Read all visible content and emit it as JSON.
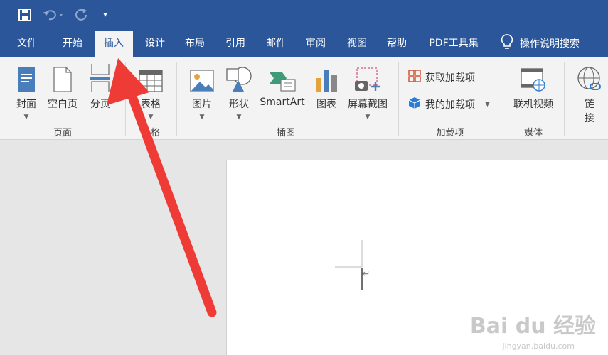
{
  "quick_access": {
    "more_symbol": "▾"
  },
  "tabs": [
    "文件",
    "开始",
    "插入",
    "设计",
    "布局",
    "引用",
    "邮件",
    "审阅",
    "视图",
    "帮助",
    "PDF工具集"
  ],
  "active_tab": "插入",
  "tell_me": "操作说明搜索",
  "ribbon": {
    "pages": {
      "cover": "封面",
      "blank": "空白页",
      "break": "分页",
      "group": "页面"
    },
    "tables": {
      "table": "表格",
      "group": "表格"
    },
    "illustrations": {
      "pictures": "图片",
      "shapes": "形状",
      "smartart": "SmartArt",
      "chart": "图表",
      "screenshot": "屏幕截图",
      "group": "插图"
    },
    "addins": {
      "get": "获取加载项",
      "mine": "我的加载项",
      "group": "加载项"
    },
    "media": {
      "video": "联机视频",
      "group": "媒体"
    },
    "links": {
      "link_1": "链",
      "link_2": "接"
    }
  },
  "document": {
    "paragraph_mark": "↵"
  },
  "watermark": {
    "brand": "Bai du 经验",
    "url": "jingyan.baidu.com"
  },
  "colors": {
    "title_bar": "#2b579a",
    "ribbon_bg": "#f3f3f3",
    "arrow": "#ee3b35"
  }
}
